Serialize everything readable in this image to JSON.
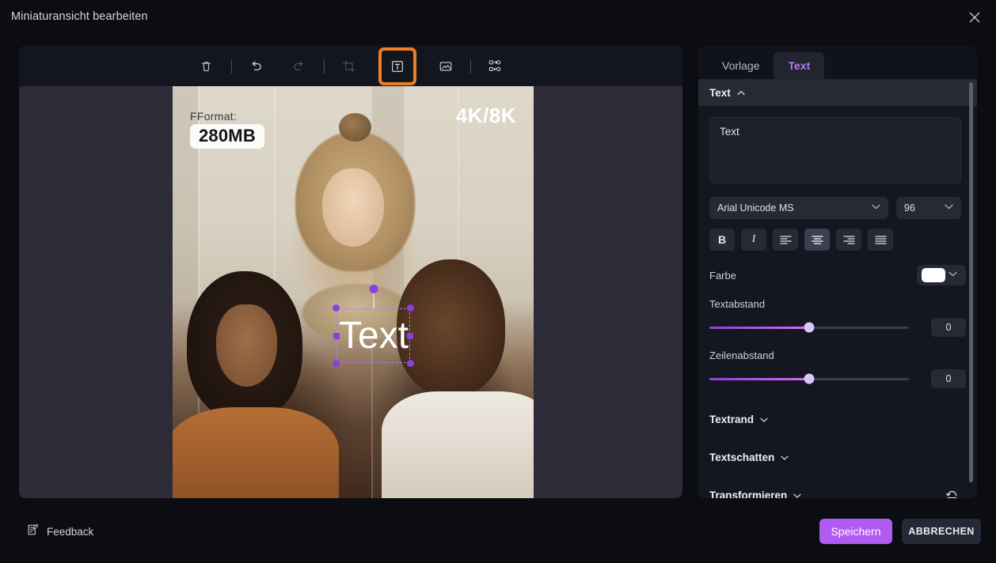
{
  "window": {
    "title": "Miniaturansicht bearbeiten",
    "close_icon": "close-icon"
  },
  "toolbar": {
    "items": [
      {
        "name": "delete-icon",
        "label": "Löschen",
        "enabled": true
      },
      {
        "name": "undo-icon",
        "label": "Rückgängig",
        "enabled": true
      },
      {
        "name": "redo-icon",
        "label": "Wiederholen",
        "enabled": false
      },
      {
        "name": "crop-icon",
        "label": "Zuschneiden",
        "enabled": false
      },
      {
        "name": "text-icon",
        "label": "Text",
        "enabled": true,
        "highlighted": true
      },
      {
        "name": "image-icon",
        "label": "Bild",
        "enabled": true
      },
      {
        "name": "replace-icon",
        "label": "Ersetzen",
        "enabled": true
      }
    ],
    "highlight_color": "#f07d20"
  },
  "canvas": {
    "overlay_label": "FFormat:",
    "overlay_badge": "280MB",
    "overlay_corner": "4K/8K",
    "selected_text": "Text",
    "selection_color": "#8b3fe0"
  },
  "panel": {
    "tabs": [
      {
        "label": "Vorlage",
        "active": false
      },
      {
        "label": "Text",
        "active": true
      }
    ],
    "section_title": "Text",
    "textarea_value": "Text",
    "font_family": "Arial Unicode MS",
    "font_size": "96",
    "format_buttons": [
      {
        "name": "bold-button",
        "glyph": "B",
        "active": false
      },
      {
        "name": "italic-button",
        "glyph": "I",
        "active": false
      },
      {
        "name": "align-left-button",
        "glyph": "align-left-icon",
        "active": false
      },
      {
        "name": "align-center-button",
        "glyph": "align-center-icon",
        "active": true
      },
      {
        "name": "align-right-button",
        "glyph": "align-right-icon",
        "active": false
      },
      {
        "name": "align-justify-button",
        "glyph": "align-justify-icon",
        "active": false
      }
    ],
    "color_label": "Farbe",
    "color_value": "#ffffff",
    "sliders": [
      {
        "label": "Textabstand",
        "value": "0",
        "percent": 50
      },
      {
        "label": "Zeilenabstand",
        "value": "0",
        "percent": 50
      }
    ],
    "collapsibles": [
      {
        "label": "Textrand"
      },
      {
        "label": "Textschatten"
      },
      {
        "label": "Transformieren",
        "has_reset": true
      }
    ]
  },
  "footer": {
    "feedback_label": "Feedback",
    "save_label": "Speichern",
    "cancel_label": "ABBRECHEN",
    "save_color": "#b05cf0"
  }
}
